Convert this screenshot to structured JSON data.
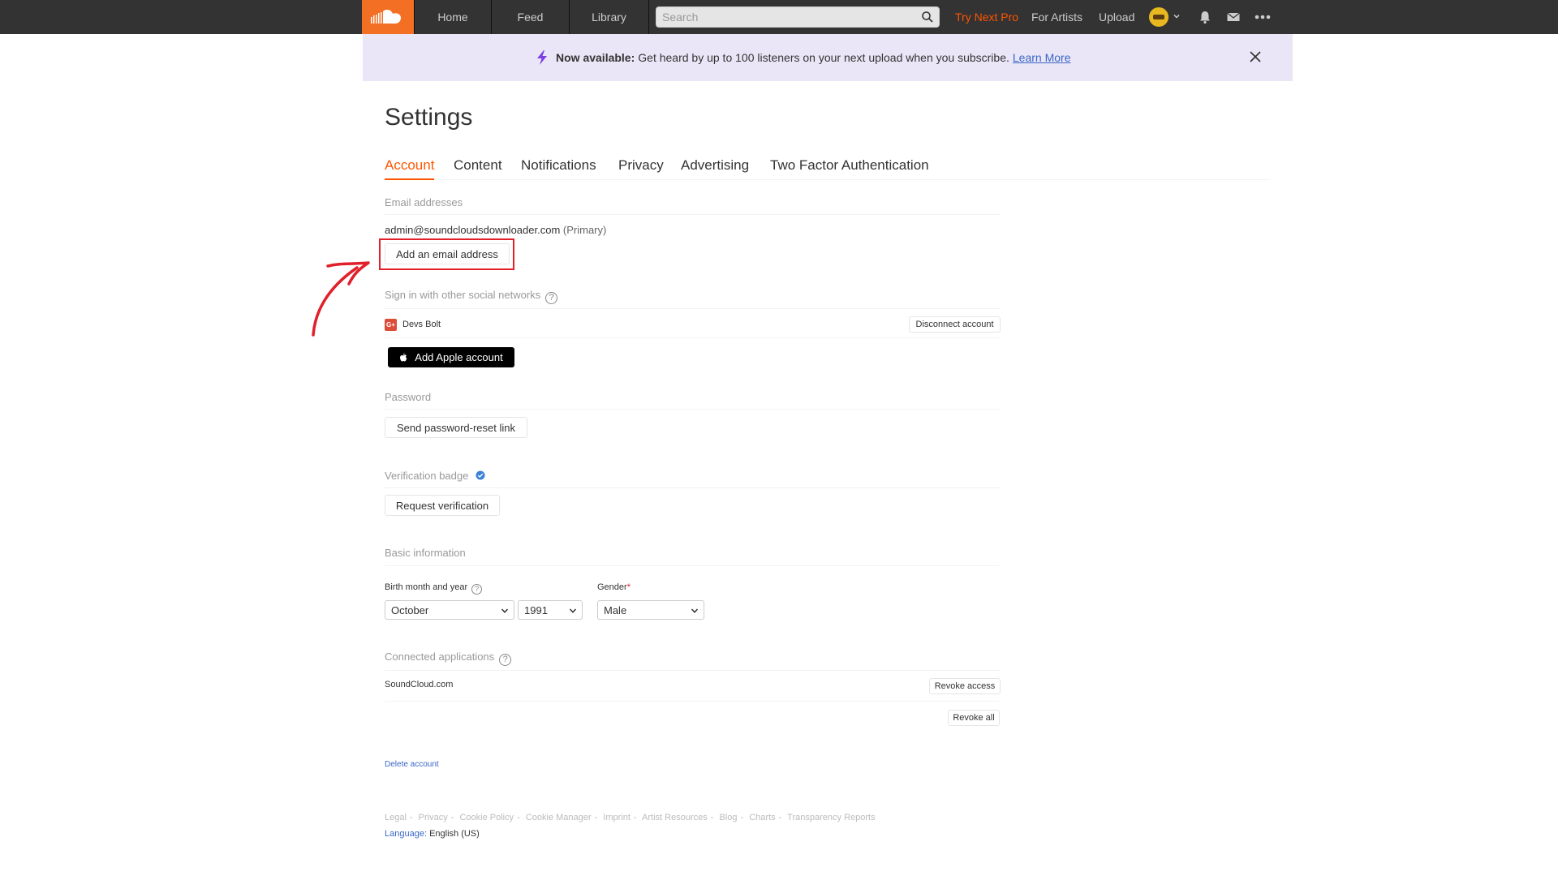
{
  "nav": {
    "tabs": [
      "Home",
      "Feed",
      "Library"
    ],
    "search_placeholder": "Search",
    "try_pro": "Try Next Pro",
    "for_artists": "For Artists",
    "upload": "Upload"
  },
  "banner": {
    "bold": "Now available:",
    "text": "Get heard by up to 100 listeners on your next upload when you subscribe.",
    "link": "Learn More"
  },
  "settings": {
    "title": "Settings",
    "tabs": [
      "Account",
      "Content",
      "Notifications",
      "Privacy",
      "Advertising",
      "Two Factor Authentication"
    ],
    "active_tab": "Account",
    "email": {
      "label": "Email addresses",
      "address": "admin@soundcloudsdownloader.com",
      "primary": "(Primary)",
      "add_button": "Add an email address"
    },
    "social": {
      "label": "Sign in with other social networks",
      "google_initial": "G+",
      "account_name": "Devs Bolt",
      "disconnect": "Disconnect account",
      "apple_button": "Add Apple account"
    },
    "password": {
      "label": "Password",
      "button": "Send password-reset link"
    },
    "verification": {
      "label": "Verification badge",
      "button": "Request verification"
    },
    "basic": {
      "label": "Basic information",
      "birth_label": "Birth month and year",
      "gender_label": "Gender",
      "required_mark": "*",
      "month": "October",
      "year": "1991",
      "gender": "Male"
    },
    "apps": {
      "label": "Connected applications",
      "app_name": "SoundCloud.com",
      "revoke": "Revoke access",
      "revoke_all": "Revoke all"
    },
    "delete_account": "Delete account"
  },
  "footer": {
    "links": [
      "Legal",
      "Privacy",
      "Cookie Policy",
      "Cookie Manager",
      "Imprint",
      "Artist Resources",
      "Blog",
      "Charts",
      "Transparency Reports"
    ],
    "language_label": "Language:",
    "language_value": "English (US)"
  },
  "colors": {
    "brand": "#f26f23",
    "accent": "#ff5500",
    "link": "#3866c6",
    "highlight": "#e0202a",
    "banner_bg": "#ebe6f7"
  }
}
